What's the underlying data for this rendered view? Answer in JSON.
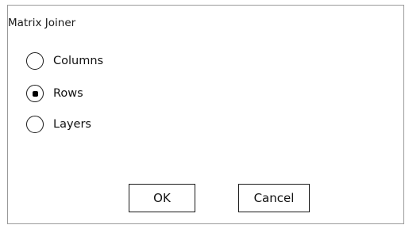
{
  "dialog": {
    "title": "Matrix Joiner",
    "options": [
      {
        "label": "Columns",
        "selected": false
      },
      {
        "label": "Rows",
        "selected": true
      },
      {
        "label": "Layers",
        "selected": false
      }
    ],
    "selected_option": "Rows",
    "ok_label": "OK",
    "cancel_label": "Cancel"
  }
}
